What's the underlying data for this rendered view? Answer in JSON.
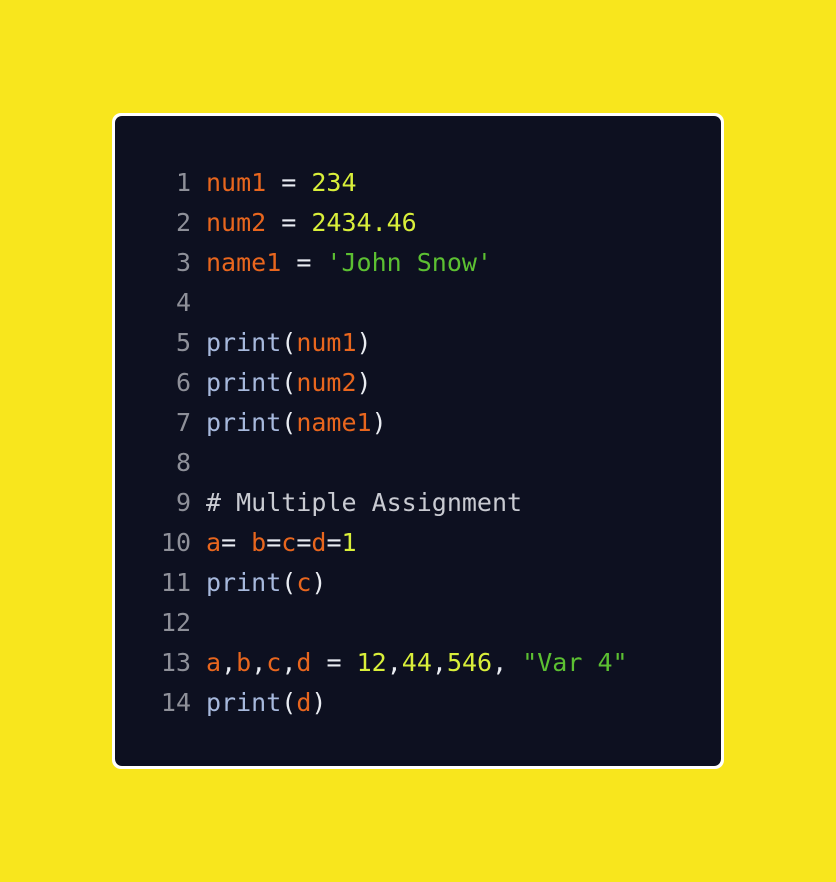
{
  "colors": {
    "page_background": "#f8e61d",
    "editor_background": "#0d1020",
    "editor_border": "#ffffff",
    "line_number": "#8e9099",
    "variable": "#e8661e",
    "operator": "#e9ecf2",
    "number": "#d9ef3a",
    "string": "#5cc032",
    "function": "#a7b9dd",
    "comment": "#c9cbd2"
  },
  "code": {
    "language": "python",
    "lines": [
      {
        "n": "1",
        "tokens": [
          {
            "t": "num1",
            "k": "var"
          },
          {
            "t": " = ",
            "k": "op"
          },
          {
            "t": "234",
            "k": "num"
          }
        ]
      },
      {
        "n": "2",
        "tokens": [
          {
            "t": "num2",
            "k": "var"
          },
          {
            "t": " = ",
            "k": "op"
          },
          {
            "t": "2434.46",
            "k": "num"
          }
        ]
      },
      {
        "n": "3",
        "tokens": [
          {
            "t": "name1",
            "k": "var"
          },
          {
            "t": " = ",
            "k": "op"
          },
          {
            "t": "'John Snow'",
            "k": "str"
          }
        ]
      },
      {
        "n": "4",
        "tokens": []
      },
      {
        "n": "5",
        "tokens": [
          {
            "t": "print",
            "k": "fn"
          },
          {
            "t": "(",
            "k": "punc"
          },
          {
            "t": "num1",
            "k": "var"
          },
          {
            "t": ")",
            "k": "punc"
          }
        ]
      },
      {
        "n": "6",
        "tokens": [
          {
            "t": "print",
            "k": "fn"
          },
          {
            "t": "(",
            "k": "punc"
          },
          {
            "t": "num2",
            "k": "var"
          },
          {
            "t": ")",
            "k": "punc"
          }
        ]
      },
      {
        "n": "7",
        "tokens": [
          {
            "t": "print",
            "k": "fn"
          },
          {
            "t": "(",
            "k": "punc"
          },
          {
            "t": "name1",
            "k": "var"
          },
          {
            "t": ")",
            "k": "punc"
          }
        ]
      },
      {
        "n": "8",
        "tokens": []
      },
      {
        "n": "9",
        "tokens": [
          {
            "t": "# Multiple Assignment",
            "k": "com"
          }
        ]
      },
      {
        "n": "10",
        "tokens": [
          {
            "t": "a",
            "k": "var"
          },
          {
            "t": "= ",
            "k": "op"
          },
          {
            "t": "b",
            "k": "var"
          },
          {
            "t": "=",
            "k": "op"
          },
          {
            "t": "c",
            "k": "var"
          },
          {
            "t": "=",
            "k": "op"
          },
          {
            "t": "d",
            "k": "var"
          },
          {
            "t": "=",
            "k": "op"
          },
          {
            "t": "1",
            "k": "num"
          }
        ]
      },
      {
        "n": "11",
        "tokens": [
          {
            "t": "print",
            "k": "fn"
          },
          {
            "t": "(",
            "k": "punc"
          },
          {
            "t": "c",
            "k": "var"
          },
          {
            "t": ")",
            "k": "punc"
          }
        ]
      },
      {
        "n": "12",
        "tokens": []
      },
      {
        "n": "13",
        "tokens": [
          {
            "t": "a",
            "k": "var"
          },
          {
            "t": ",",
            "k": "punc"
          },
          {
            "t": "b",
            "k": "var"
          },
          {
            "t": ",",
            "k": "punc"
          },
          {
            "t": "c",
            "k": "var"
          },
          {
            "t": ",",
            "k": "punc"
          },
          {
            "t": "d",
            "k": "var"
          },
          {
            "t": " = ",
            "k": "op"
          },
          {
            "t": "12",
            "k": "num"
          },
          {
            "t": ",",
            "k": "punc"
          },
          {
            "t": "44",
            "k": "num"
          },
          {
            "t": ",",
            "k": "punc"
          },
          {
            "t": "546",
            "k": "num"
          },
          {
            "t": ", ",
            "k": "punc"
          },
          {
            "t": "\"Var 4\"",
            "k": "str"
          }
        ]
      },
      {
        "n": "14",
        "tokens": [
          {
            "t": "print",
            "k": "fn"
          },
          {
            "t": "(",
            "k": "punc"
          },
          {
            "t": "d",
            "k": "var"
          },
          {
            "t": ")",
            "k": "punc"
          }
        ]
      }
    ]
  }
}
